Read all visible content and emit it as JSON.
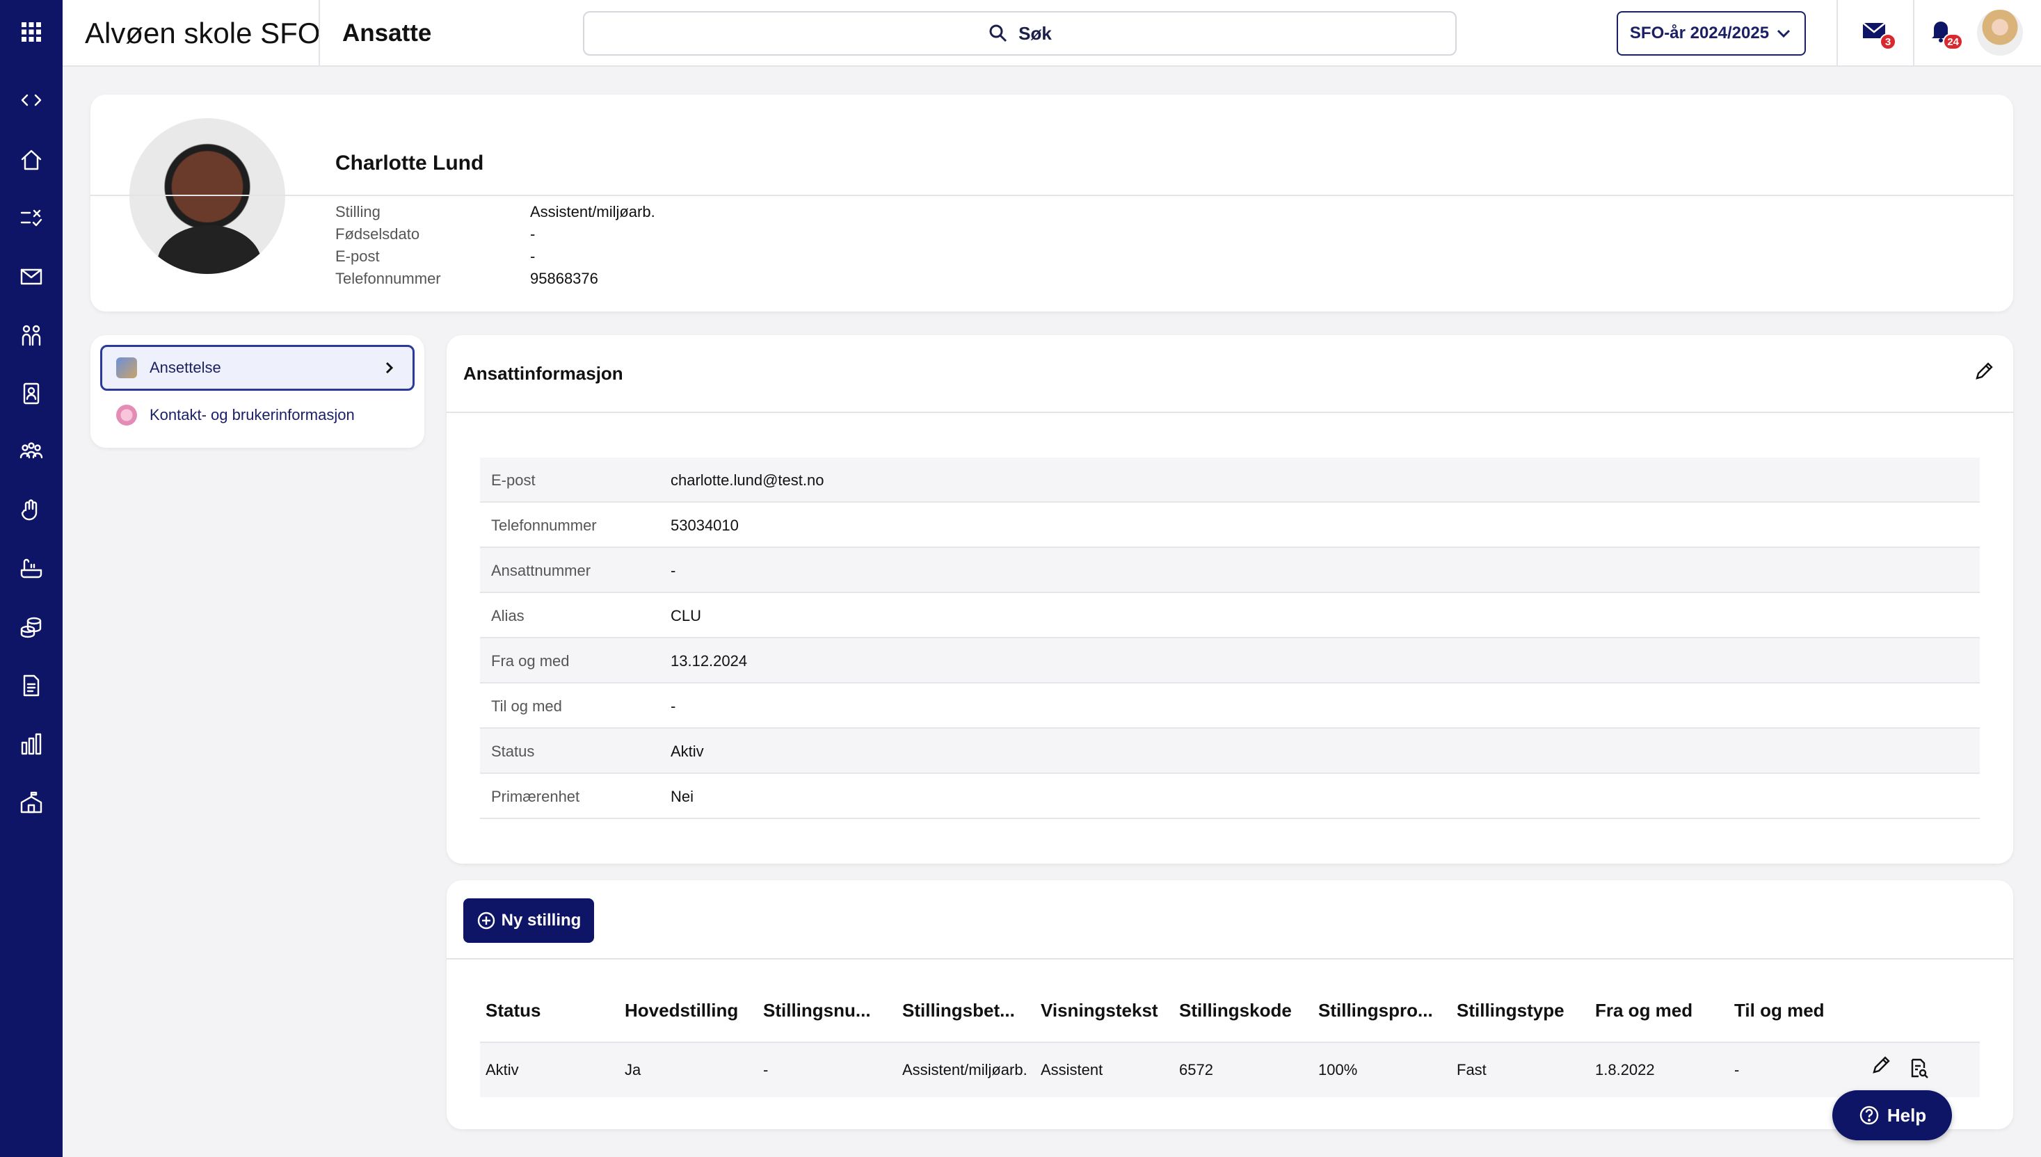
{
  "header": {
    "app_title": "Alvøen skole SFO",
    "page_title": "Ansatte",
    "search_label": "Søk",
    "year_selector": "SFO-år 2024/2025",
    "messages_badge": "3",
    "notifications_badge": "24"
  },
  "sidebar": {
    "icons": [
      "apps-grid-icon",
      "expand-collapse-icon",
      "home-icon",
      "tasks-icon",
      "mail-icon",
      "groups-icon",
      "id-badge-icon",
      "people-icon",
      "hand-icon",
      "bath-icon",
      "coins-icon",
      "document-icon",
      "bar-chart-icon",
      "school-icon"
    ]
  },
  "profile": {
    "name": "Charlotte Lund",
    "fields": [
      {
        "label": "Stilling",
        "value": "Assistent/miljøarb."
      },
      {
        "label": "Fødselsdato",
        "value": "-"
      },
      {
        "label": "E-post",
        "value": "-"
      },
      {
        "label": "Telefonnummer",
        "value": "95868376"
      }
    ]
  },
  "nav": {
    "items": [
      {
        "label": "Ansettelse"
      },
      {
        "label": "Kontakt- og brukerinformasjon"
      }
    ]
  },
  "info": {
    "title": "Ansattinformasjon",
    "rows": [
      {
        "label": "E-post",
        "value": "charlotte.lund@test.no"
      },
      {
        "label": "Telefonnummer",
        "value": "53034010"
      },
      {
        "label": "Ansattnummer",
        "value": "-"
      },
      {
        "label": "Alias",
        "value": "CLU"
      },
      {
        "label": "Fra og med",
        "value": "13.12.2024"
      },
      {
        "label": "Til og med",
        "value": "-"
      },
      {
        "label": "Status",
        "value": "Aktiv"
      },
      {
        "label": "Primærenhet",
        "value": "Nei"
      }
    ]
  },
  "positions": {
    "new_button": "Ny stilling",
    "columns": [
      "Status",
      "Hovedstilling",
      "Stillingsnu...",
      "Stillingsbet...",
      "Visningstekst",
      "Stillingskode",
      "Stillingspro...",
      "Stillingstype",
      "Fra og med",
      "Til og med"
    ],
    "rows": [
      [
        "Aktiv",
        "Ja",
        "-",
        "Assistent/miljøarb.",
        "Assistent",
        "6572",
        "100%",
        "Fast",
        "1.8.2022",
        "-"
      ]
    ]
  },
  "help": {
    "label": "Help"
  },
  "colors": {
    "brand": "#0f1566",
    "badge": "#d8292f",
    "accent_border": "#2a3a9a"
  }
}
